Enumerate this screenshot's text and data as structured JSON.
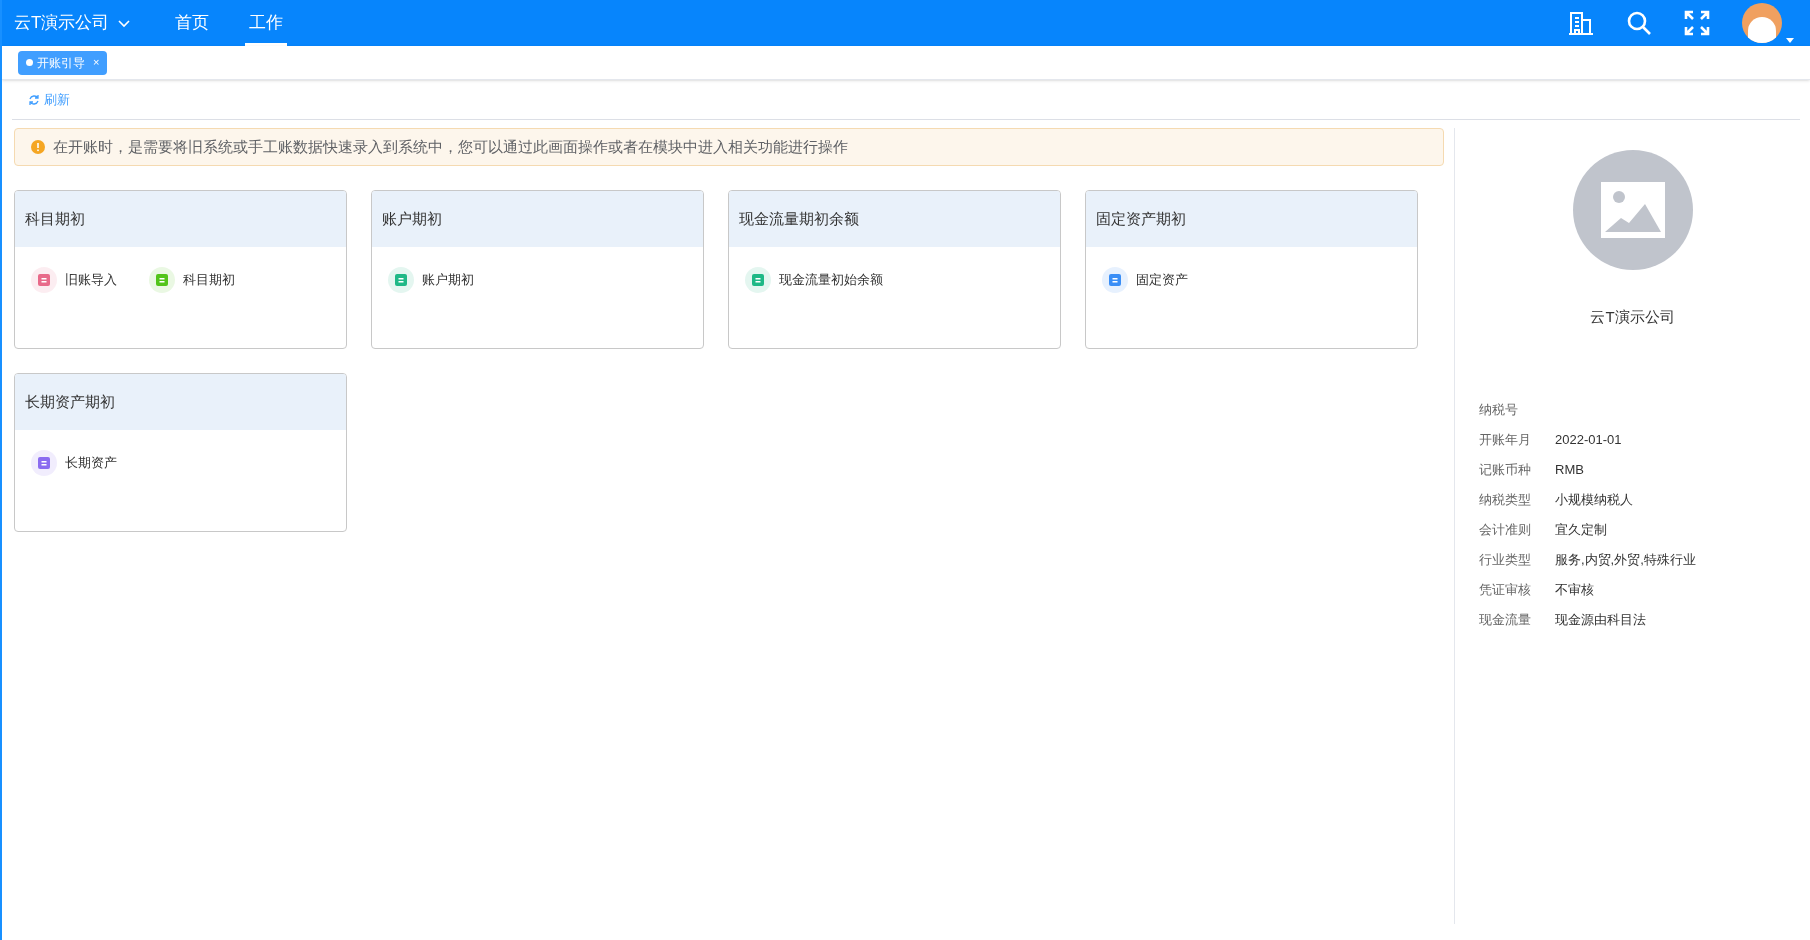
{
  "topbar": {
    "company": "云T演示公司",
    "nav": [
      {
        "label": "首页",
        "selected": false
      },
      {
        "label": "工作",
        "selected": true
      }
    ]
  },
  "tabs": [
    {
      "label": "开账引导",
      "selected": true,
      "close": "×"
    }
  ],
  "toolbar": {
    "refresh": "刷新"
  },
  "notice": "在开账时，是需要将旧系统或手工账数据快速录入到系统中，您可以通过此画面操作或者在模块中进入相关功能进行操作",
  "cards": [
    {
      "title": "科目期初",
      "items": [
        {
          "label": "旧账导入",
          "color": "#e86a8a"
        },
        {
          "label": "科目期初",
          "color": "#52c41a"
        }
      ]
    },
    {
      "title": "账户期初",
      "items": [
        {
          "label": "账户期初",
          "color": "#1fb886"
        }
      ]
    },
    {
      "title": "现金流量期初余额",
      "items": [
        {
          "label": "现金流量初始余额",
          "color": "#1fb886"
        }
      ]
    },
    {
      "title": "固定资产期初",
      "items": [
        {
          "label": "固定资产",
          "color": "#3a8ef6"
        }
      ]
    },
    {
      "title": "长期资产期初",
      "items": [
        {
          "label": "长期资产",
          "color": "#8b6cf0"
        }
      ]
    }
  ],
  "company_panel": {
    "name": "云T演示公司",
    "fields": [
      {
        "label": "纳税号"
      },
      {
        "label": "开账年月",
        "value": "2022-01-01"
      },
      {
        "label": "记账币种",
        "value": "RMB"
      },
      {
        "label": "纳税类型",
        "value": "小规模纳税人"
      },
      {
        "label": "会计准则",
        "value": "宜久定制"
      },
      {
        "label": "行业类型",
        "value": "服务,内贸,外贸,特殊行业"
      },
      {
        "label": "凭证审核",
        "value": "不审核"
      },
      {
        "label": "现金流量",
        "value": "现金源由科目法"
      }
    ]
  }
}
